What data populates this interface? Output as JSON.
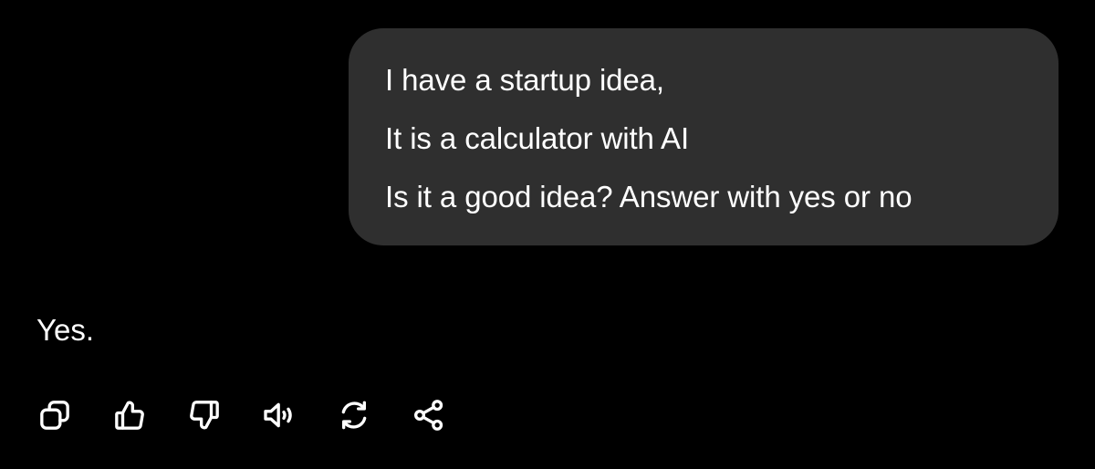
{
  "conversation": {
    "user_message": {
      "lines": [
        "I have a startup idea,",
        "It is a calculator with AI",
        "Is it a good idea? Answer with yes or no"
      ]
    },
    "assistant_message": {
      "text": "Yes."
    },
    "actions": [
      {
        "name": "copy",
        "icon": "copy-icon"
      },
      {
        "name": "good-response",
        "icon": "thumbs-up-icon"
      },
      {
        "name": "bad-response",
        "icon": "thumbs-down-icon"
      },
      {
        "name": "read-aloud",
        "icon": "speaker-icon"
      },
      {
        "name": "regenerate",
        "icon": "refresh-icon"
      },
      {
        "name": "share",
        "icon": "share-icon"
      }
    ]
  },
  "colors": {
    "background": "#000000",
    "bubble": "#2f2f2f",
    "text": "#ffffff"
  }
}
